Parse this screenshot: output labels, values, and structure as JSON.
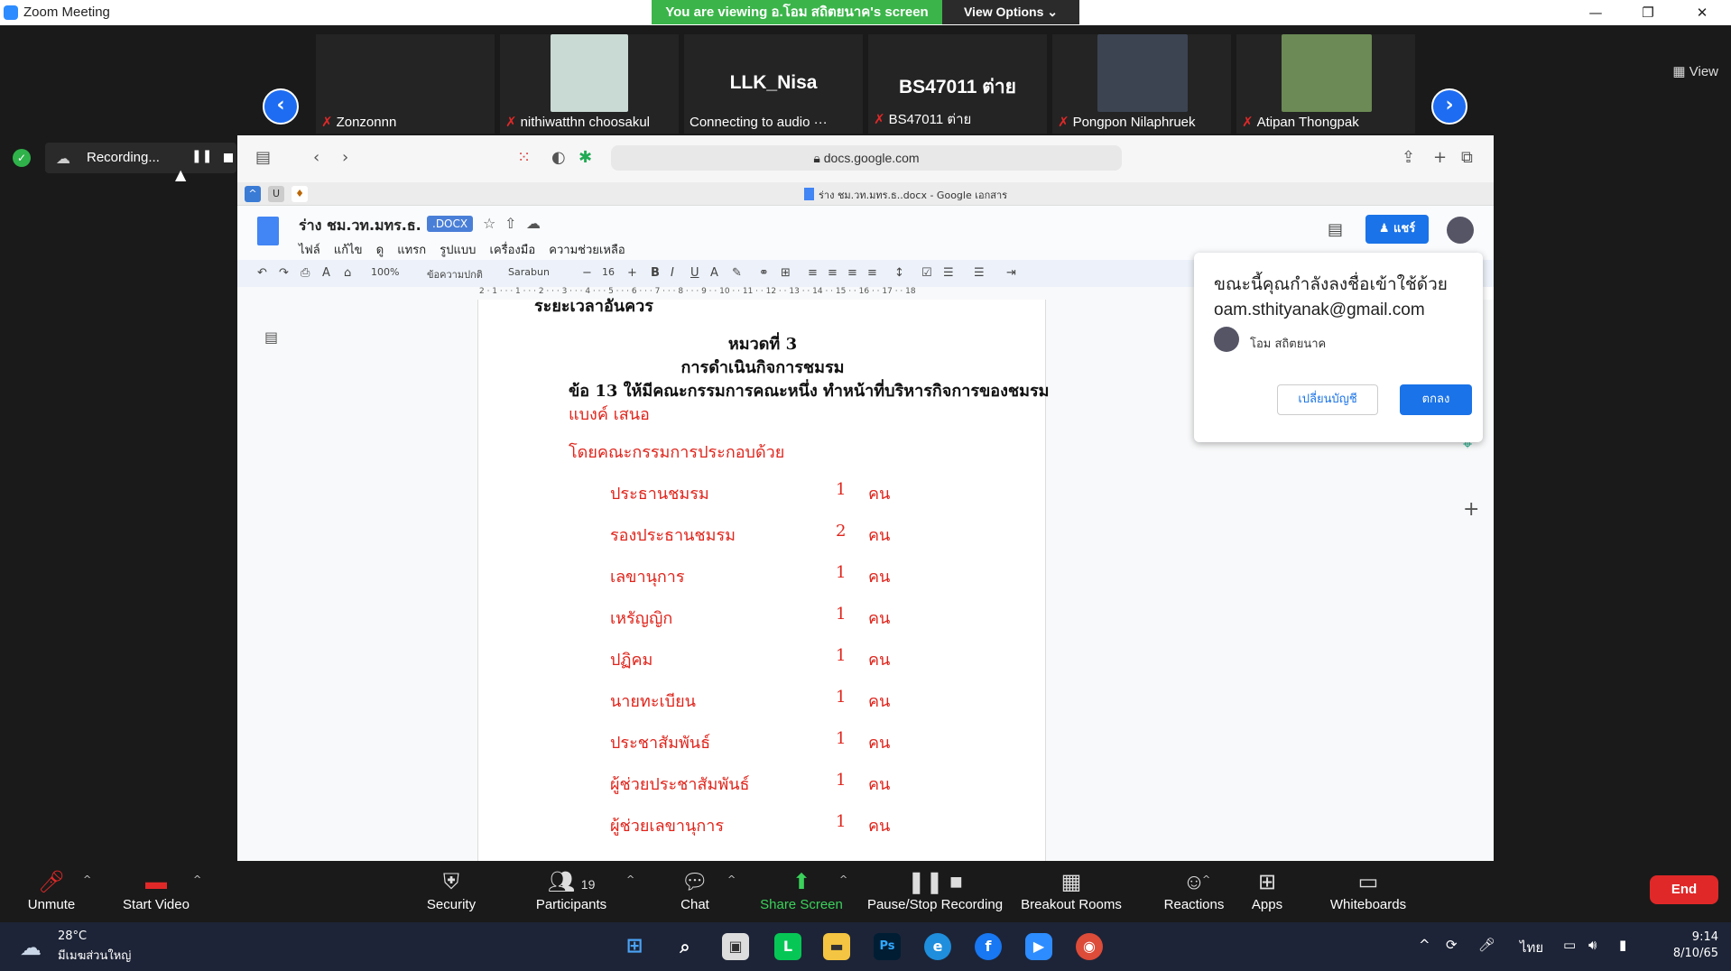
{
  "window": {
    "title": "Zoom Meeting",
    "minimize": "—",
    "maximize": "❐",
    "close": "✕"
  },
  "banner": {
    "text": "You are viewing อ.โอม สถิตยนาค's screen",
    "view_options": "View Options ⌄"
  },
  "gallery": {
    "view_label": "View",
    "participants": [
      {
        "name": "Zonzonnn",
        "big_label": ""
      },
      {
        "name": "nithiwatthn choosakul",
        "big_label": ""
      },
      {
        "name": "Connecting to audio ···",
        "big_label": "LLK_Nisa"
      },
      {
        "name": "BS47011 ต่าย",
        "big_label": "BS47011 ต่าย"
      },
      {
        "name": "Pongpon Nilaphruek",
        "big_label": ""
      },
      {
        "name": "Atipan Thongpak",
        "big_label": ""
      }
    ]
  },
  "recording": {
    "label": "Recording..."
  },
  "browser": {
    "url": "docs.google.com",
    "tab_title": "ร่าง ชม.วท.มทร.ธ..docx - Google เอกสาร"
  },
  "docs": {
    "title": "ร่าง ชม.วท.มทร.ธ.",
    "badge": ".DOCX",
    "menus": [
      "ไฟล์",
      "แก้ไข",
      "ดู",
      "แทรก",
      "รูปแบบ",
      "เครื่องมือ",
      "ความช่วยเหลือ"
    ],
    "share": "แชร์",
    "toolbar": {
      "zoom": "100%",
      "style": "ข้อความปกติ",
      "font": "Sarabun",
      "size": "16"
    },
    "ruler": "2 · 1 · · · 1 · · · 2 · · · 3 · · · 4 · · · 5 · · · 6 · · · 7 · · · 8 · · · 9 · · 10 · · 11 · · 12 · · 13 · · 14 · · 15 · · 16 · · 17 · · 18"
  },
  "content": {
    "cut_top": "ระยะเวลาอันควร",
    "heading1": "หมวดที่ 3",
    "heading2": "การดำเนินกิจการชมรม",
    "clause": "ข้อ 13 ให้มีคณะกรรมการคณะหนึ่ง ทำหน้าที่บริหารกิจการของชมรม",
    "note": "แบงค์ เสนอ",
    "intro": "โดยคณะกรรมการประกอบด้วย",
    "members": [
      {
        "role": "ประธานชมรม",
        "count": "1",
        "unit": "คน"
      },
      {
        "role": "รองประธานชมรม",
        "count": "2",
        "unit": "คน"
      },
      {
        "role": "เลขานุการ",
        "count": "1",
        "unit": "คน"
      },
      {
        "role": "เหรัญญิก",
        "count": "1",
        "unit": "คน"
      },
      {
        "role": "ปฏิคม",
        "count": "1",
        "unit": "คน"
      },
      {
        "role": "นายทะเบียน",
        "count": "1",
        "unit": "คน"
      },
      {
        "role": "ประชาสัมพันธ์",
        "count": "1",
        "unit": "คน"
      },
      {
        "role": "ผู้ช่วยประชาสัมพันธ์",
        "count": "1",
        "unit": "คน"
      },
      {
        "role": "ผู้ช่วยเลขานุการ",
        "count": "1",
        "unit": "คน"
      }
    ]
  },
  "popup": {
    "line1": "ขณะนี้คุณกำลังลงชื่อเข้าใช้ด้วย",
    "line2": "oam.sthityanak@gmail.com",
    "account_name": "โอม สถิตยนาค",
    "switch": "เปลี่ยนบัญชี",
    "ok": "ตกลง"
  },
  "controls": {
    "unmute": "Unmute",
    "start_video": "Start Video",
    "security": "Security",
    "participants": "Participants",
    "participants_count": "19",
    "chat": "Chat",
    "share_screen": "Share Screen",
    "pause_stop": "Pause/Stop Recording",
    "breakout": "Breakout Rooms",
    "reactions": "Reactions",
    "apps": "Apps",
    "whiteboards": "Whiteboards",
    "end": "End"
  },
  "taskbar": {
    "temp": "28°C",
    "condition": "มีเมฆส่วนใหญ่",
    "lang": "ไทย",
    "time": "9:14",
    "date": "8/10/65"
  },
  "colors": {
    "accent": "#1a73e8",
    "zoom_blue": "#2d8cff",
    "banner_green": "#3bb54a",
    "end_red": "#e02828",
    "doc_red": "#e0241b"
  }
}
